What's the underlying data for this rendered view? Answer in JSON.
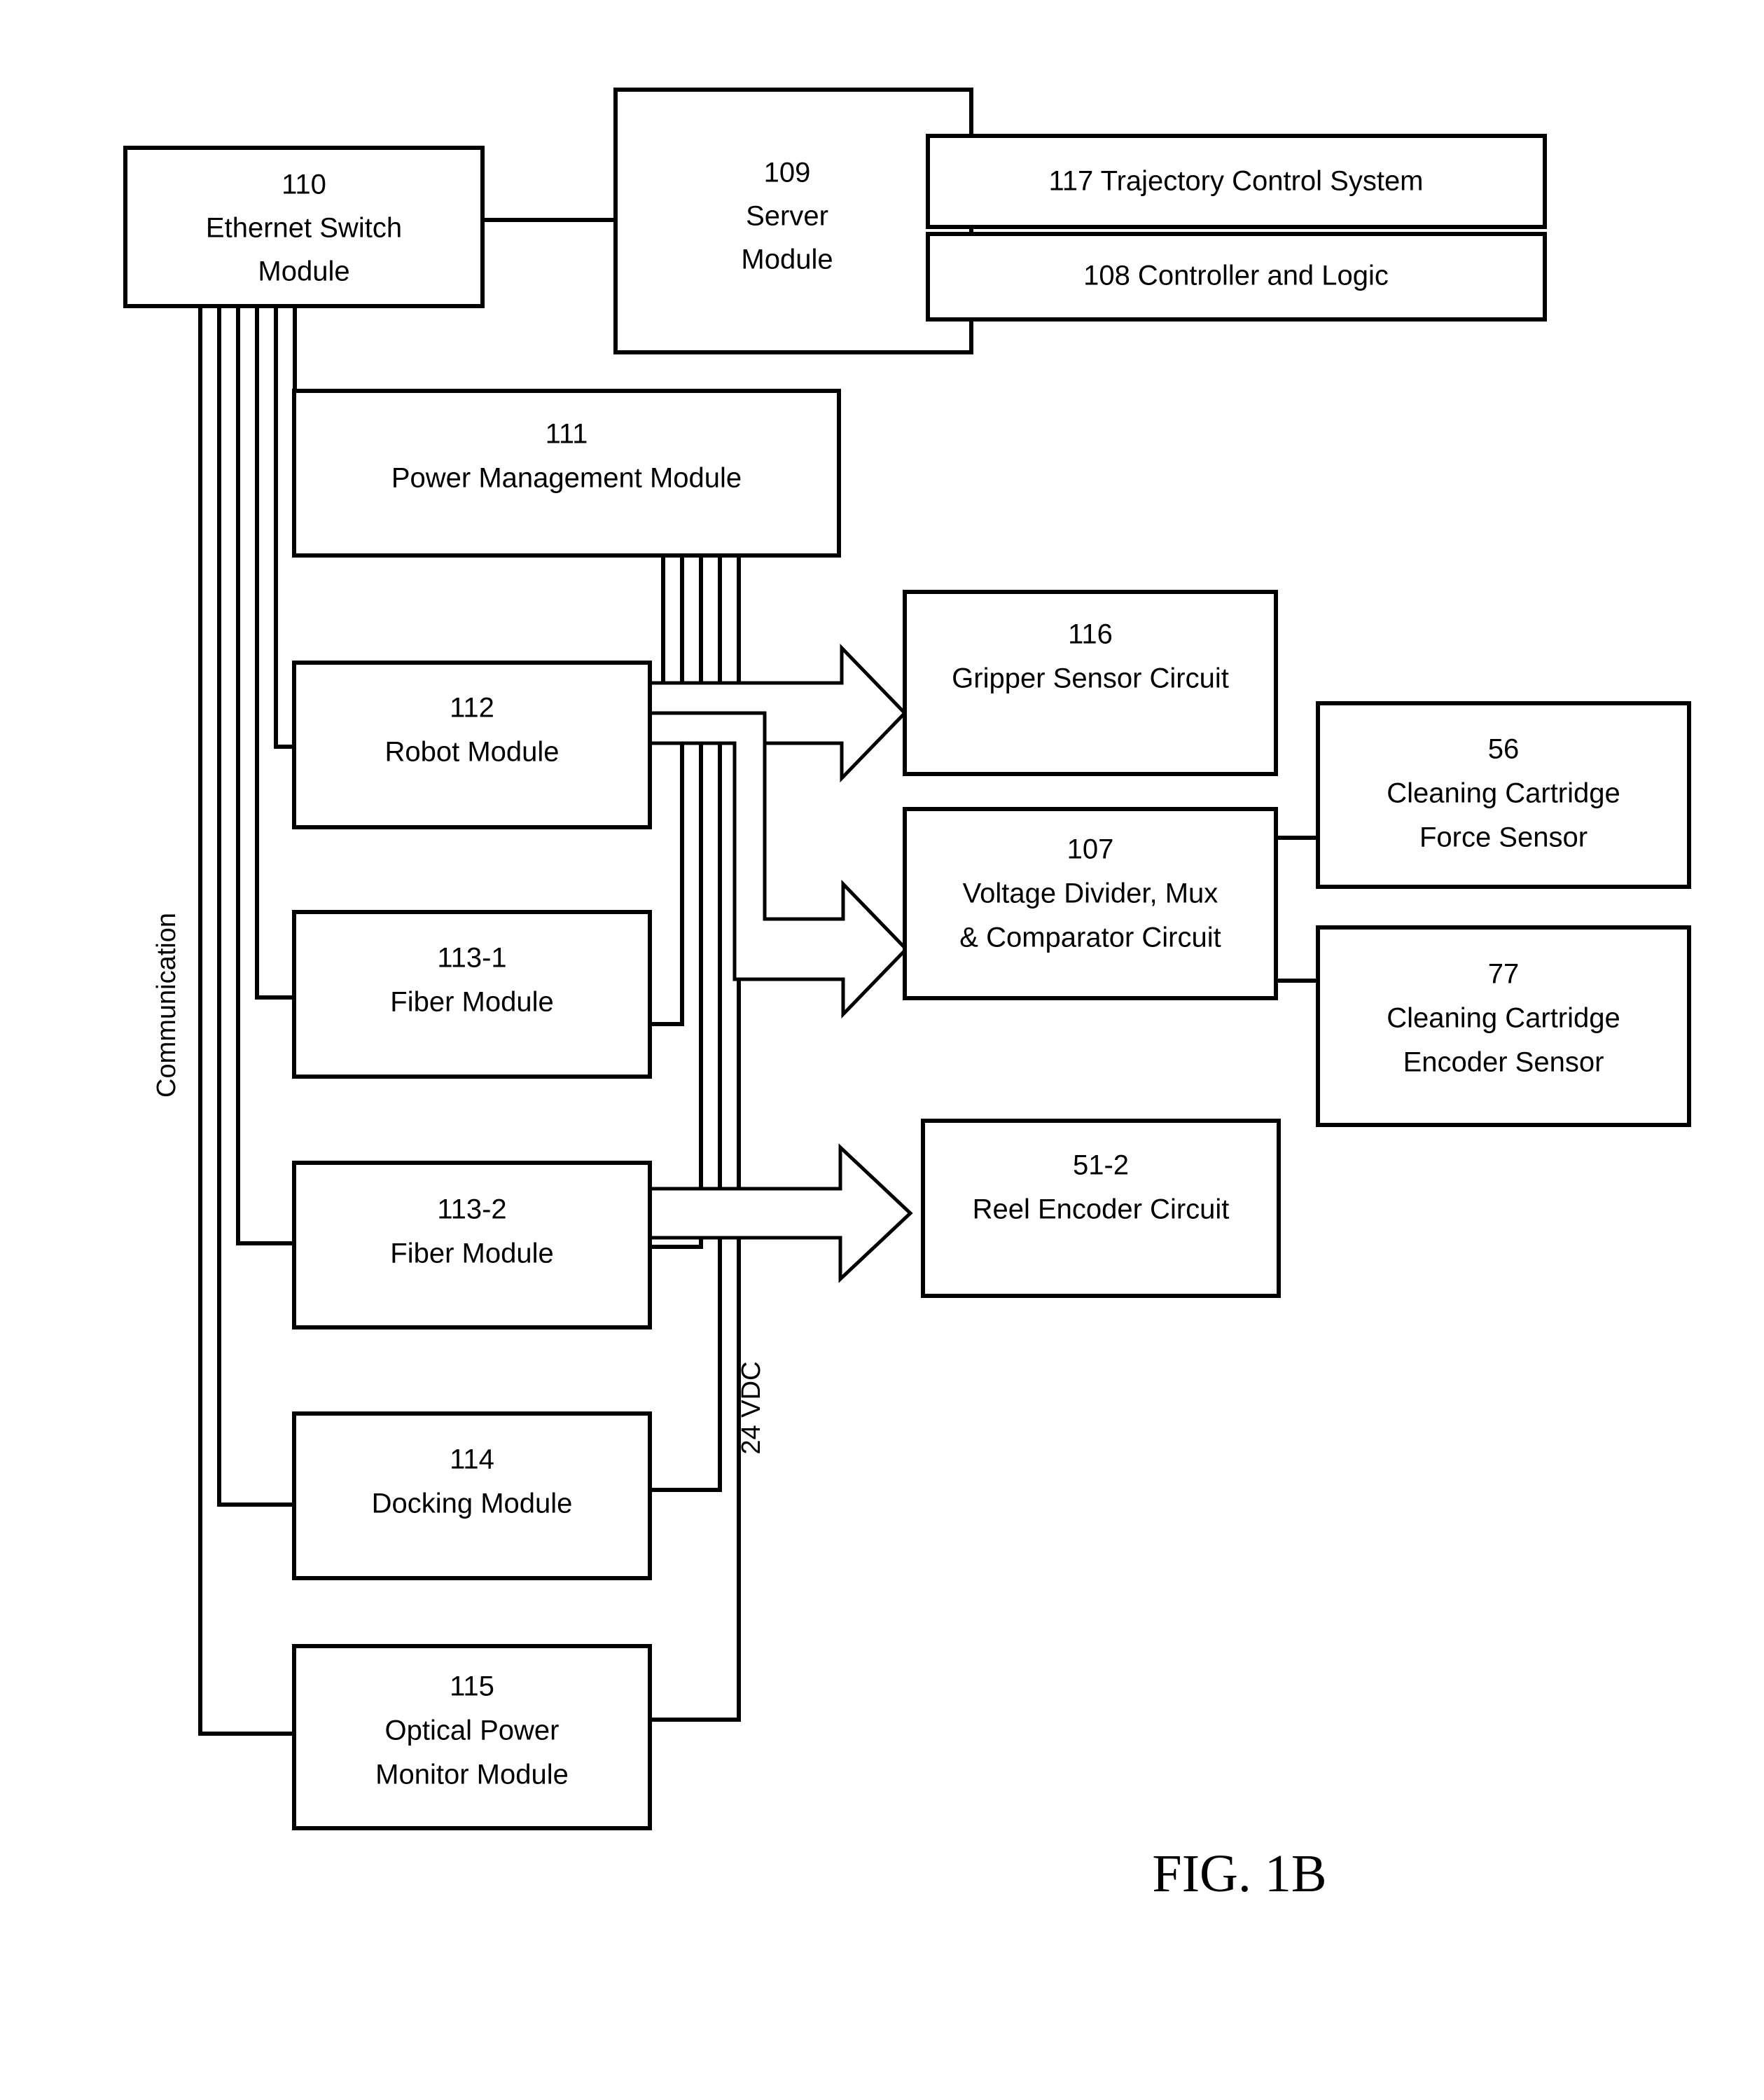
{
  "figure": {
    "caption": "FIG. 1B",
    "bus_labels": {
      "communication": "Communication",
      "power": "24 VDC"
    }
  },
  "blocks": {
    "ethernet_switch": {
      "ref": "110",
      "line1": "Ethernet Switch",
      "line2": "Module"
    },
    "server": {
      "ref": "109",
      "line1": "Server",
      "line2": "Module"
    },
    "trajectory": {
      "label": "117 Trajectory Control System"
    },
    "controller": {
      "label": "108 Controller and Logic"
    },
    "power_mgmt": {
      "ref": "111",
      "line1": "Power Management Module"
    },
    "robot": {
      "ref": "112",
      "line1": "Robot Module"
    },
    "fiber_1": {
      "ref": "113-1",
      "line1": "Fiber Module"
    },
    "fiber_2": {
      "ref": "113-2",
      "line1": "Fiber Module"
    },
    "docking": {
      "ref": "114",
      "line1": "Docking Module"
    },
    "optical_power": {
      "ref": "115",
      "line1": "Optical Power",
      "line2": "Monitor Module"
    },
    "gripper_sensor": {
      "ref": "116",
      "line1": "Gripper Sensor Circuit"
    },
    "voltage_divider": {
      "ref": "107",
      "line1": "Voltage Divider, Mux",
      "line2": "& Comparator Circuit"
    },
    "reel_encoder": {
      "ref": "51-2",
      "line1": "Reel Encoder Circuit"
    },
    "force_sensor": {
      "ref": "56",
      "line1": "Cleaning Cartridge",
      "line2": "Force Sensor"
    },
    "encoder_sensor": {
      "ref": "77",
      "line1": "Cleaning Cartridge",
      "line2": "Encoder Sensor"
    }
  },
  "colors": {
    "stroke": "#000000",
    "background": "#ffffff"
  }
}
